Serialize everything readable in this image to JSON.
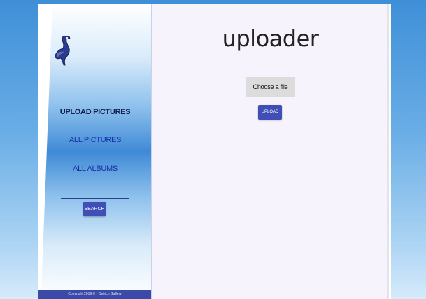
{
  "sidebar": {
    "nav": [
      {
        "label": "UPLOAD PICTURES",
        "active": true
      },
      {
        "label": "ALL PICTURES",
        "active": false
      },
      {
        "label": "ALL ALBUMS",
        "active": false
      }
    ],
    "search_label": "SEARCH",
    "footer_text": "Copyright 2019 © - Ostrich Gallery"
  },
  "main": {
    "title": "uploader",
    "choose_file_label": "Choose a file",
    "upload_label": "UPLOAD"
  },
  "colors": {
    "accent": "#3f4fb5",
    "footer": "#3b4aa9",
    "main_bg": "#f7f3fd",
    "page_bg": "#3f8fd8"
  },
  "icons": {
    "logo": "ostrich-icon"
  }
}
